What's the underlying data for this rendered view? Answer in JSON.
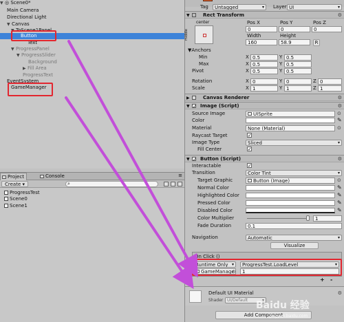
{
  "hierarchy": {
    "scene": "Scene0*",
    "items": [
      {
        "label": "Main Camera"
      },
      {
        "label": "Directional Light"
      },
      {
        "label": "Canvas"
      },
      {
        "label": "ToScene1Panel"
      },
      {
        "label": "Button"
      },
      {
        "label": "Text"
      },
      {
        "label": "ProgressPanel"
      },
      {
        "label": "ProgressSlider"
      },
      {
        "label": "Background"
      },
      {
        "label": "Fill Area"
      },
      {
        "label": "ProgressText"
      },
      {
        "label": "EventSystem"
      },
      {
        "label": "GameManager"
      }
    ]
  },
  "project": {
    "tabs": [
      "Project",
      "Console"
    ],
    "create_label": "Create ▾",
    "items": [
      "ProgressTest",
      "Scene0",
      "Scene1"
    ]
  },
  "inspector": {
    "tag_label": "Tag",
    "tag_value": "Untagged",
    "layer_label": "Layer",
    "layer_value": "UI",
    "rect_transform": {
      "title": "Rect Transform",
      "anchor_preset_label": "center",
      "anchor_preset_side": "middle",
      "col_headers": [
        "Pos X",
        "Pos Y",
        "Pos Z"
      ],
      "pos_values": [
        "0",
        "0",
        "0"
      ],
      "size_headers": [
        "Width",
        "Height"
      ],
      "size_values": [
        "160",
        "58.9"
      ],
      "raw_edit": "R",
      "anchors_label": "Anchors",
      "min_label": "Min",
      "min_x": "0.5",
      "min_y": "0.5",
      "max_label": "Max",
      "max_x": "0.5",
      "max_y": "0.5",
      "pivot_label": "Pivot",
      "pivot_x": "0.5",
      "pivot_y": "0.5",
      "rotation_label": "Rotation",
      "rot_x": "0",
      "rot_y": "0",
      "rot_z": "0",
      "scale_label": "Scale",
      "scale_x": "1",
      "scale_y": "1",
      "scale_z": "1",
      "x_letter": "X",
      "y_letter": "Y",
      "z_letter": "Z"
    },
    "canvas_renderer": {
      "title": "Canvas Renderer"
    },
    "image": {
      "title": "Image (Script)",
      "source_image_label": "Source Image",
      "source_image_value": "UISprite",
      "color_label": "Color",
      "material_label": "Material",
      "material_value": "None (Material)",
      "raycast_label": "Raycast Target",
      "image_type_label": "Image Type",
      "image_type_value": "Sliced",
      "fill_center_label": "Fill Center"
    },
    "button": {
      "title": "Button (Script)",
      "interactable_label": "Interactable",
      "transition_label": "Transition",
      "transition_value": "Color Tint",
      "target_graphic_label": "Target Graphic",
      "target_graphic_value": "Button (Image)",
      "normal_color_label": "Normal Color",
      "highlighted_color_label": "Highlighted Color",
      "pressed_color_label": "Pressed Color",
      "disabled_color_label": "Disabled Color",
      "color_multiplier_label": "Color Multiplier",
      "color_multiplier_value": "1",
      "fade_duration_label": "Fade Duration",
      "fade_duration_value": "0.1",
      "navigation_label": "Navigation",
      "navigation_value": "Automatic",
      "visualize_label": "Visualize",
      "onclick_label": "On Click ()",
      "runtime_value": "Runtime Only",
      "function_value": "ProgressTest.LoadLevel",
      "object_value": "GameManage",
      "arg_value": "1",
      "plus_label": "+",
      "minus_label": "-"
    },
    "default_material": {
      "title": "Default UI Material",
      "shader_label": "Shader",
      "shader_value": "UI/Default"
    },
    "add_component_label": "Add Component",
    "watermark": "Baidu 经验",
    "watermark_url": "jingyan.baidu.com"
  },
  "colors": {
    "selection": "#3d83d9",
    "highlight_box": "#e2262f",
    "arrow": "#c24fd9"
  }
}
